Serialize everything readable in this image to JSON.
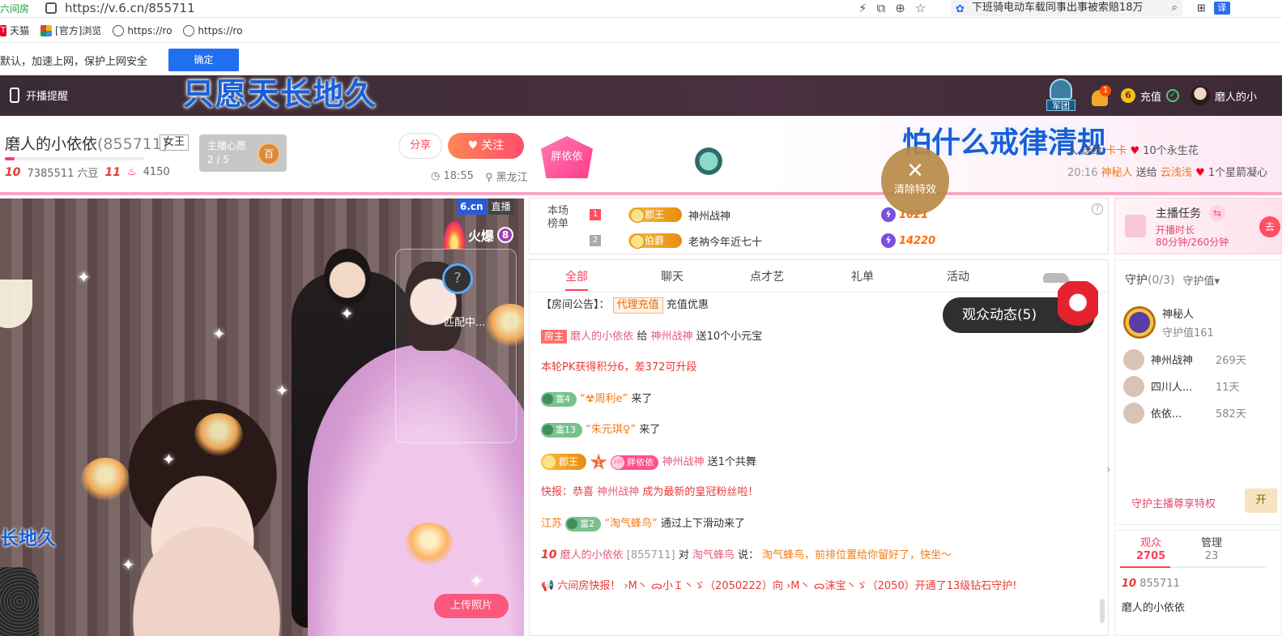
{
  "browser": {
    "site_label": "六间房",
    "url": "https://v.6.cn/855711",
    "search_text": "下班骑电动车载同事出事被索赔18万",
    "translate_label": "译"
  },
  "bookmarks": [
    {
      "label": "天猫"
    },
    {
      "label": "[官方]浏览"
    },
    {
      "label": "https://ro"
    },
    {
      "label": "https://ro"
    }
  ],
  "notice": {
    "text": "默认，加速上网，保护上网安全",
    "confirm_label": "确定"
  },
  "header": {
    "live_remind": "开播提醒",
    "overlay_text": "只愿天长地久",
    "army_label": "军团",
    "bell_count": "1",
    "coin_symbol": "6",
    "recharge": "充值",
    "user_name": "磨人的小"
  },
  "host": {
    "name": "磨人的小依依",
    "room_id": "(855711)",
    "tag": "女王",
    "level": "10",
    "beans": "7385511 六豆",
    "fan_level": "11",
    "fans": "4150",
    "wish_title": "主播心愿",
    "wish_count": "2 / 5",
    "wish_medal": "百",
    "share": "分享",
    "follow": "关注",
    "time": "18:55",
    "location": "黑龙江",
    "fan_badge": "胖依依",
    "overlay_right": "怕什么戒律清规"
  },
  "gift_feed": [
    {
      "from": "人",
      "action": "送给",
      "to": "卡卡",
      "gift": "10个永生花"
    },
    {
      "time": "20:16",
      "from": "神秘人",
      "action": "送给",
      "to": "云浅浅",
      "gift": "1个星箭凝心"
    }
  ],
  "clear_fx": {
    "label": "清除特效",
    "symbol": "✕"
  },
  "video": {
    "logo": "6.cn",
    "live": "直播",
    "hot_label": "火爆",
    "hot_level": "8",
    "matching": "匹配中...",
    "left_overlay": "长地久",
    "upload": "上传照片"
  },
  "rank": {
    "title": "本场榜单",
    "rows": [
      {
        "num": "1",
        "noble": "郡王",
        "name": "神州战神",
        "value": "1621"
      },
      {
        "num": "2",
        "noble": "伯爵",
        "name": "老衲今年近七十",
        "value": "14220"
      }
    ]
  },
  "chat": {
    "tabs": [
      "全部",
      "聊天",
      "点才艺",
      "礼单",
      "活动"
    ],
    "announcement_prefix": "【房间公告】：",
    "announcement_tag": "代理充值",
    "announcement_text": "充值优惠",
    "messages": [
      {
        "badge": "房主",
        "user": "磨人的小依依",
        "verb": "给",
        "target": "神州战神",
        "text": "送10个小元宝"
      },
      {
        "text": "本轮PK获得积分6，差372可升段"
      },
      {
        "fu": "富4",
        "name": "“☢周利e”",
        "text": "来了"
      },
      {
        "fu": "富13",
        "name": "“朱元琪♀”",
        "text": "来了"
      },
      {
        "noble": "郡王",
        "star": "1",
        "fan": "胖依依",
        "user": "神州战神",
        "text": "送1个共舞"
      },
      {
        "prefix": "快报：恭喜",
        "user": "神州战神",
        "text": "成为最新的皇冠粉丝啦！"
      },
      {
        "region": "江苏",
        "fu": "富2",
        "name": "“淘气蜂鸟”",
        "text": "通过上下滑动来了"
      },
      {
        "level": "10",
        "user": "磨人的小依依",
        "rid": "[855711]",
        "verb": "对",
        "target": "淘气蜂鸟",
        "say": "说：",
        "text": "淘气蜂鸟，前排位置给你留好了，快坐～"
      },
      {
        "text": "六间房快报！ ›M丶 ᯅ小Ｉ丶ゞ（2050222）向 ›M丶 ᯅ沫宝丶ゞ（2050）开通了13级钻石守护!"
      }
    ],
    "viewer_pill": "观众动态(5)"
  },
  "task": {
    "title": "主播任务",
    "line1": "开播时长",
    "line2": "80分钟/260分钟",
    "swap_icon": "⇆",
    "go": "去"
  },
  "guard": {
    "title": "守护",
    "count": "(0/3)",
    "sort": "守护值▾",
    "top_name": "神秘人",
    "top_value": "守护值161",
    "list": [
      {
        "name": "神州战神",
        "days": "269天"
      },
      {
        "name": "四川人...",
        "days": "11天"
      },
      {
        "name": "依依...",
        "days": "582天"
      }
    ],
    "privilege": "守护主播尊享特权",
    "privilege_btn": "开"
  },
  "audience": {
    "tab1_label": "观众",
    "tab1_count": "2705",
    "tab2_label": "管理",
    "tab2_count": "23",
    "item_level": "10",
    "item_id": "855711",
    "item_name": "磨人的小依依"
  },
  "colors": {
    "accent": "#ff3b5c",
    "overlay_blue": "#1b5fd6",
    "header_bg": "#3a2b35"
  }
}
